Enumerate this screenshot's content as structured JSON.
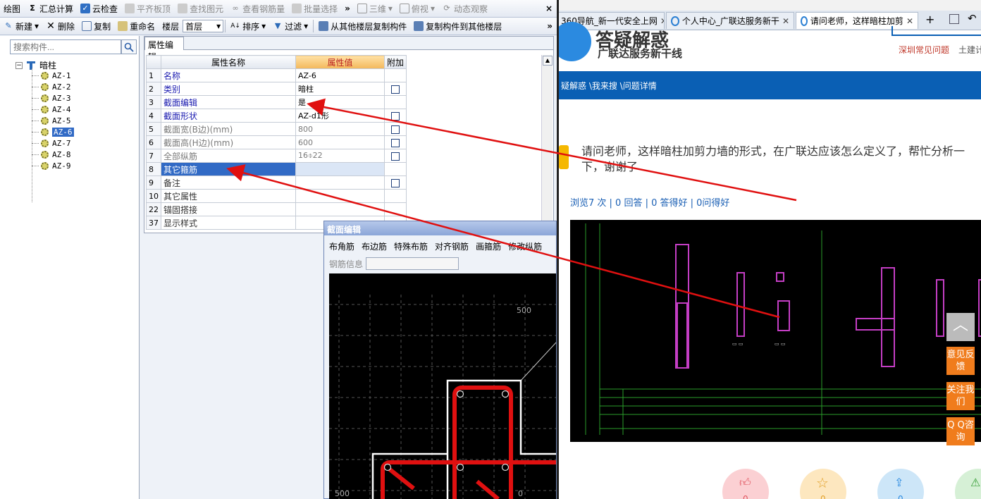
{
  "app": {
    "toolbar1": {
      "draw": "绘图",
      "sum": "汇总计算",
      "cloud_check": "云检查",
      "flush_top": "平齐板顶",
      "find_element": "查找图元",
      "view_rebar_qty": "查看钢筋量",
      "batch_select": "批量选择",
      "view_3d": "三维",
      "top_view": "俯视",
      "dynamic_view": "动态观察"
    },
    "toolbar2": {
      "new": "新建",
      "delete": "删除",
      "copy": "复制",
      "rename": "重命名",
      "floor_label": "楼层",
      "floor_value": "首层",
      "sort": "排序",
      "filter": "过滤",
      "copy_from_other": "从其他楼层复制构件",
      "copy_to_other": "复制构件到其他楼层"
    },
    "tree": {
      "search_placeholder": "搜索构件...",
      "root": "暗柱",
      "items": [
        "AZ-1",
        "AZ-2",
        "AZ-3",
        "AZ-4",
        "AZ-5",
        "AZ-6",
        "AZ-7",
        "AZ-8",
        "AZ-9"
      ],
      "selected": "AZ-6"
    },
    "prop_editor": {
      "tab": "属性编辑",
      "col_name": "属性名称",
      "col_value": "属性值",
      "col_extra": "附加",
      "rows": [
        {
          "num": "1",
          "name": "名称",
          "value": "AZ-6",
          "check": false
        },
        {
          "num": "2",
          "name": "类别",
          "value": "暗柱",
          "check": true
        },
        {
          "num": "3",
          "name": "截面编辑",
          "value": "是",
          "check": false
        },
        {
          "num": "4",
          "name": "截面形状",
          "value": "AZ-d1形",
          "check": true
        },
        {
          "num": "5",
          "name": "截面宽(B边)(mm)",
          "value": "800",
          "check": true
        },
        {
          "num": "6",
          "name": "截面高(H边)(mm)",
          "value": "600",
          "check": true
        },
        {
          "num": "7",
          "name": "全部纵筋",
          "value": "16⌽22",
          "check": true
        },
        {
          "num": "8",
          "name": "其它箍筋",
          "value": "",
          "check": false
        },
        {
          "num": "9",
          "name": "备注",
          "value": "",
          "check": true
        },
        {
          "num": "10",
          "name": "其它属性",
          "value": "",
          "check": false
        },
        {
          "num": "22",
          "name": "锚固搭接",
          "value": "",
          "check": false
        },
        {
          "num": "37",
          "name": "显示样式",
          "value": "",
          "check": false
        }
      ]
    },
    "section_dialog": {
      "title": "截面编辑",
      "tools": [
        "布角筋",
        "布边筋",
        "特殊布筋",
        "对齐钢筋",
        "画箍筋",
        "修改纵筋"
      ],
      "rebar_info": "钢筋信息",
      "cad_labels": [
        "500",
        "500",
        "0"
      ]
    }
  },
  "browser": {
    "tabs": [
      {
        "label": "360导航_新一代安全上网"
      },
      {
        "label": "个人中心_广联达服务新干"
      },
      {
        "label": "请问老师，这样暗柱加剪"
      }
    ],
    "header": {
      "logo_text": "答疑解惑",
      "slogan": "广联达服务新干线",
      "link1": "深圳常见问题",
      "link2": "土建计"
    },
    "breadcrumb": "疑解惑 \\我来搜 \\问题详情",
    "question_title": "请问老师，这样暗柱加剪力墙的形式，在广联达应该怎么定义了，帮忙分析一下，谢谢了",
    "stats": "浏览7 次 | 0 回答 | 0 答得好 | 0问得好",
    "side_buttons": [
      "意见反馈",
      "关注我们",
      "Q Q咨询"
    ],
    "action_counts": [
      "0",
      "0",
      "0"
    ]
  }
}
